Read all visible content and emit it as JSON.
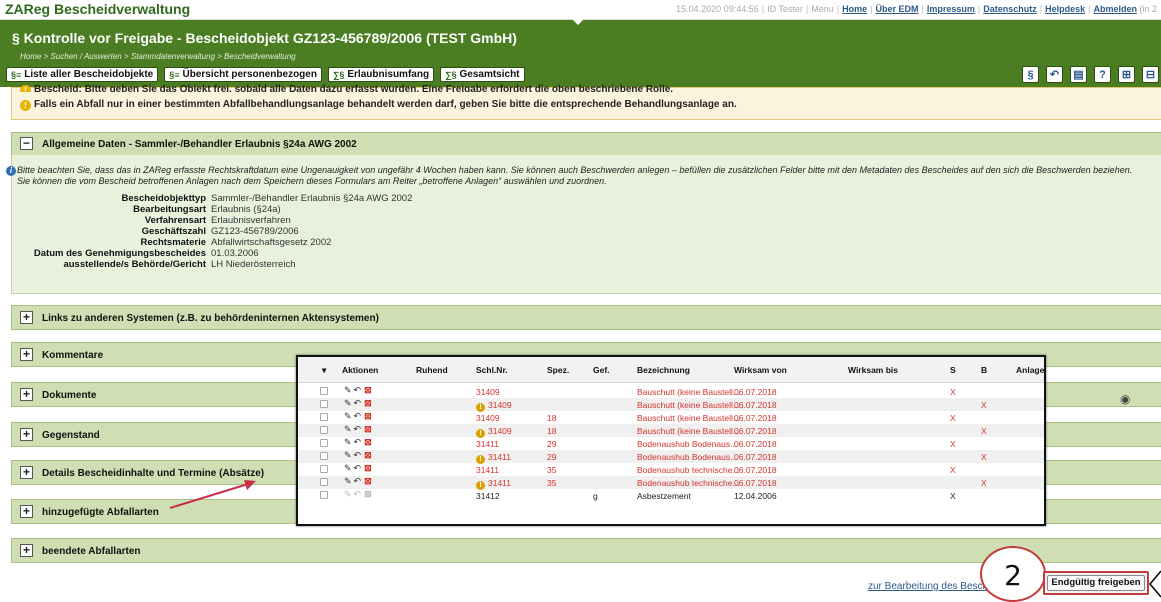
{
  "topbar": {
    "app_title": "ZAReg Bescheidverwaltung",
    "datetime": "15.04.2020 09:44:56",
    "user": "ID Tester",
    "links": [
      "Menu",
      "Home",
      "Über EDM",
      "Impressum",
      "Datenschutz",
      "Helpdesk",
      "Abmelden"
    ],
    "trailing": "(in 2"
  },
  "header": {
    "title": "§ Kontrolle vor Freigabe - Bescheidobjekt GZ123-456789/2006 (TEST GmbH)",
    "breadcrumb": "Home > Suchen / Auswerten > Stammdatenverwaltung > Bescheidverwaltung",
    "buttons": [
      {
        "icon": "§≡",
        "label": "Liste aller Bescheidobjekte"
      },
      {
        "icon": "§≡",
        "label": "Übersicht personenbezogen"
      },
      {
        "icon": "∑§",
        "label": "Erlaubnisumfang"
      },
      {
        "icon": "∑§",
        "label": "Gesamtsicht"
      }
    ]
  },
  "notice": {
    "line1": "Bescheid: Bitte geben Sie das Objekt frei, sobald alle Daten dazu erfasst wurden. Eine Freigabe erfordert die oben beschriebene Rolle.",
    "line2": "Falls ein Abfall nur in einer bestimmten Abfallbehandlungsanlage behandelt werden darf, geben Sie bitte die entsprechende Behandlungsanlage an."
  },
  "general": {
    "title": "Allgemeine Daten - Sammler-/Behandler Erlaubnis §24a AWG 2002",
    "info": "Bitte beachten Sie, dass das in ZAReg erfasste Rechtskraftdatum eine Ungenauigkeit von ungefähr 4 Wochen haben kann. Sie können auch Beschwerden anlegen – befüllen die zusätzlichen Felder bitte mit den Metadaten des Bescheides auf den sich die Beschwerden beziehen. Sie können die vom Bescheid betroffenen Anlagen nach dem Speichern dieses Formulars am Reiter „betroffene Anlagen“ auswählen und zuordnen.",
    "fields": [
      {
        "k": "Bescheidobjekttyp",
        "v": "Sammler-/Behandler Erlaubnis §24a AWG 2002"
      },
      {
        "k": "Bearbeitungsart",
        "v": "Erlaubnis (§24a)"
      },
      {
        "k": "Verfahrensart",
        "v": "Erlaubnisverfahren"
      },
      {
        "k": "Geschäftszahl",
        "v": "GZ123-456789/2006"
      },
      {
        "k": "Rechtsmaterie",
        "v": "Abfallwirtschaftsgesetz 2002"
      },
      {
        "k": "Datum des Genehmigungsbescheides",
        "v": "01.03.2006"
      },
      {
        "k": "ausstellende/s Behörde/Gericht",
        "v": "LH Niederösterreich"
      }
    ]
  },
  "panels": [
    "Links zu anderen Systemen (z.B. zu behördeninternen Aktensystemen)",
    "Kommentare",
    "Dokumente",
    "Gegenstand",
    "Details Bescheidinhalte und Termine (Absätze)",
    "hinzugefügte Abfallarten",
    "beendete Abfallarten"
  ],
  "table": {
    "sort_indicator": "▾",
    "headers": [
      "Aktionen",
      "Ruhend",
      "Schl.Nr.",
      "Spez.",
      "Gef.",
      "Bezeichnung",
      "Wirksam von",
      "Wirksam bis",
      "S",
      "B",
      "Anlage"
    ],
    "rows": [
      {
        "schl": "31409",
        "warn": false,
        "spez": "",
        "gef": "",
        "bez": "Bauschutt (keine Baustell...",
        "von": "06.07.2018",
        "bis": "",
        "s": "X",
        "b": "",
        "red": true
      },
      {
        "schl": "31409",
        "warn": true,
        "spez": "",
        "gef": "",
        "bez": "Bauschutt (keine Baustell...",
        "von": "06.07.2018",
        "bis": "",
        "s": "",
        "b": "X",
        "red": true
      },
      {
        "schl": "31409",
        "warn": false,
        "spez": "18",
        "gef": "",
        "bez": "Bauschutt (keine Baustell...",
        "von": "06.07.2018",
        "bis": "",
        "s": "X",
        "b": "",
        "red": true
      },
      {
        "schl": "31409",
        "warn": true,
        "spez": "18",
        "gef": "",
        "bez": "Bauschutt (keine Baustell...",
        "von": "06.07.2018",
        "bis": "",
        "s": "",
        "b": "X",
        "red": true
      },
      {
        "schl": "31411",
        "warn": false,
        "spez": "29",
        "gef": "",
        "bez": "Bodenaushub Bodenaus...",
        "von": "06.07.2018",
        "bis": "",
        "s": "X",
        "b": "",
        "red": true
      },
      {
        "schl": "31411",
        "warn": true,
        "spez": "29",
        "gef": "",
        "bez": "Bodenaushub Bodenaus...",
        "von": "06.07.2018",
        "bis": "",
        "s": "",
        "b": "X",
        "red": true
      },
      {
        "schl": "31411",
        "warn": false,
        "spez": "35",
        "gef": "",
        "bez": "Bodenaushub technische...",
        "von": "06.07.2018",
        "bis": "",
        "s": "X",
        "b": "",
        "red": true
      },
      {
        "schl": "31411",
        "warn": true,
        "spez": "35",
        "gef": "",
        "bez": "Bodenaushub technische...",
        "von": "06.07.2018",
        "bis": "",
        "s": "",
        "b": "X",
        "red": true
      },
      {
        "schl": "31412",
        "warn": false,
        "spez": "",
        "gef": "g",
        "bez": "Asbestzement",
        "von": "12.04.2006",
        "bis": "",
        "s": "X",
        "b": "",
        "red": false
      }
    ]
  },
  "footer": {
    "link": "zur Bearbeitung des Besch",
    "callout": "2",
    "final_button": "Endgültig freigeben"
  },
  "colors": {
    "header_green": "#4b7d23",
    "panel_green": "#cfdfb3",
    "red_text": "#d3342b",
    "highlight_red": "#c43b3b"
  }
}
